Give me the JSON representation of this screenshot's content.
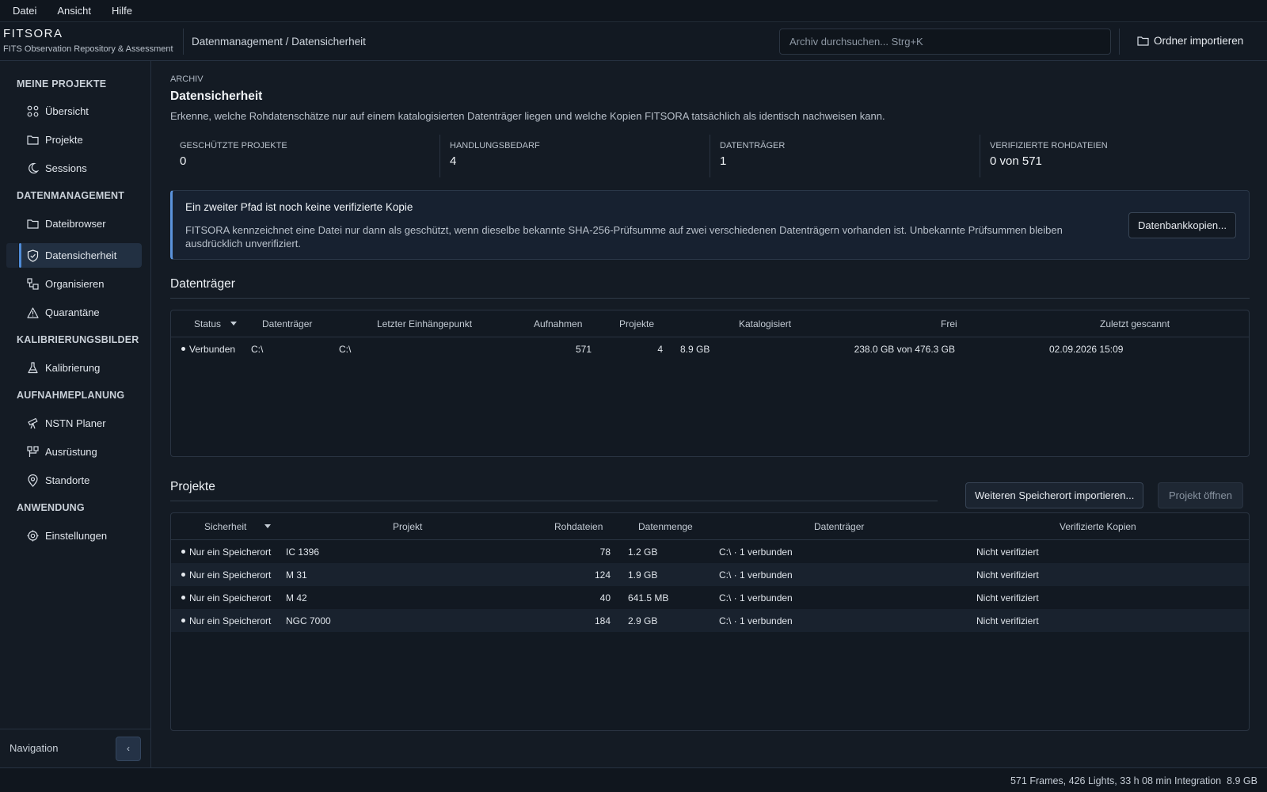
{
  "menu": [
    "Datei",
    "Ansicht",
    "Hilfe"
  ],
  "brand": {
    "name": "FITSORA",
    "subtitle": "FITS Observation Repository & Assessment"
  },
  "breadcrumb": "Datenmanagement / Datensicherheit",
  "search": {
    "placeholder": "Archiv durchsuchen...  Strg+K"
  },
  "header_action": "Ordner importieren",
  "sidebar": {
    "sections": [
      {
        "title": "MEINE PROJEKTE",
        "items": [
          {
            "label": "Übersicht",
            "icon": "grid-icon"
          },
          {
            "label": "Projekte",
            "icon": "folder-icon"
          },
          {
            "label": "Sessions",
            "icon": "moon-icon"
          }
        ]
      },
      {
        "title": "DATENMANAGEMENT",
        "items": [
          {
            "label": "Dateibrowser",
            "icon": "folder-icon"
          },
          {
            "label": "Datensicherheit",
            "icon": "shield-check-icon",
            "active": true
          },
          {
            "label": "Organisieren",
            "icon": "organize-icon"
          },
          {
            "label": "Quarantäne",
            "icon": "warning-icon"
          }
        ]
      },
      {
        "title": "KALIBRIERUNGSBILDER",
        "items": [
          {
            "label": "Kalibrierung",
            "icon": "flask-icon"
          }
        ]
      },
      {
        "title": "AUFNAHMEPLANUNG",
        "items": [
          {
            "label": "NSTN Planer",
            "icon": "telescope-icon"
          },
          {
            "label": "Ausrüstung",
            "icon": "equipment-icon"
          },
          {
            "label": "Standorte",
            "icon": "map-pin-icon"
          }
        ]
      },
      {
        "title": "ANWENDUNG",
        "items": [
          {
            "label": "Einstellungen",
            "icon": "settings-icon"
          }
        ]
      }
    ],
    "footer_label": "Navigation",
    "collapse_glyph": "‹"
  },
  "page": {
    "kicker": "ARCHIV",
    "title": "Datensicherheit",
    "description": "Erkenne, welche Rohdatenschätze nur auf einem katalogisierten Datenträger liegen und welche Kopien FITSORA tatsächlich als identisch nachweisen kann."
  },
  "stats": [
    {
      "label": "Geschützte Projekte",
      "value": "0"
    },
    {
      "label": "Handlungsbedarf",
      "value": "4"
    },
    {
      "label": "Datenträger",
      "value": "1"
    },
    {
      "label": "Verifizierte Rohdateien",
      "value": "0 von 571"
    }
  ],
  "notice": {
    "title": "Ein zweiter Pfad ist noch keine verifizierte Kopie",
    "text": "FITSORA kennzeichnet eine Datei nur dann als geschützt, wenn dieselbe bekannte SHA-256-Prüfsumme auf zwei verschiedenen Datenträgern vorhanden ist. Unbekannte Prüfsummen bleiben ausdrücklich unverifiziert.",
    "button": "Datenbankkopien..."
  },
  "volumes": {
    "title": "Datenträger",
    "columns": [
      "Status",
      "Datenträger",
      "Letzter Einhängepunkt",
      "Aufnahmen",
      "Projekte",
      "Katalogisiert",
      "Frei",
      "Zuletzt gescannt"
    ],
    "rows": [
      {
        "status": "Verbunden",
        "volume": "C:\\",
        "mount": "C:\\",
        "captures": "571",
        "projects": "4",
        "cataloged": "8.9 GB",
        "free": "238.0 GB von 476.3 GB",
        "scanned": "02.09.2026 15:09"
      }
    ]
  },
  "projects": {
    "title": "Projekte",
    "import_button": "Weiteren Speicherort importieren...",
    "open_button": "Projekt öffnen",
    "columns": [
      "Sicherheit",
      "Projekt",
      "Rohdateien",
      "Datenmenge",
      "Datenträger",
      "Verifizierte Kopien"
    ],
    "rows": [
      {
        "safety": "Nur ein Speicherort",
        "project": "IC 1396",
        "files": "78",
        "size": "1.2 GB",
        "volumes": "C:\\ · 1 verbunden",
        "verified": "Nicht verifiziert"
      },
      {
        "safety": "Nur ein Speicherort",
        "project": "M 31",
        "files": "124",
        "size": "1.9 GB",
        "volumes": "C:\\ · 1 verbunden",
        "verified": "Nicht verifiziert"
      },
      {
        "safety": "Nur ein Speicherort",
        "project": "M 42",
        "files": "40",
        "size": "641.5 MB",
        "volumes": "C:\\ · 1 verbunden",
        "verified": "Nicht verifiziert"
      },
      {
        "safety": "Nur ein Speicherort",
        "project": "NGC 7000",
        "files": "184",
        "size": "2.9 GB",
        "volumes": "C:\\ · 1 verbunden",
        "verified": "Nicht verifiziert"
      }
    ]
  },
  "statusbar": {
    "summary": "571 Frames, 426 Lights, 33 h 08 min Integration",
    "size": "8.9 GB"
  }
}
